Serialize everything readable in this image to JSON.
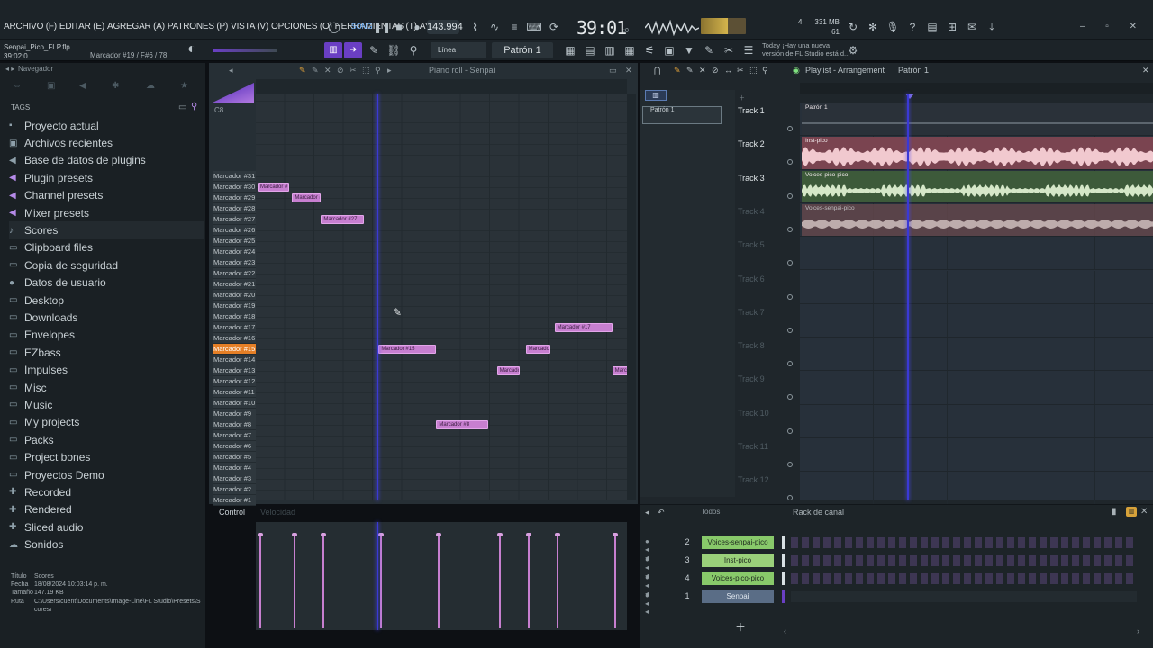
{
  "menu": [
    "ARCHIVO (F)",
    "EDITAR (E)",
    "AGREGAR (A)",
    "PATRONES (P)",
    "VISTA (V)",
    "OPCIONES (O)",
    "HERRAMIENTAS (T)",
    "AYUDA"
  ],
  "transport": {
    "tempo": "143.994",
    "clock": "39:01",
    "clock_sub": ":0",
    "memory": "331 MB",
    "memory_sub": "61",
    "cpu_value": "4"
  },
  "project": {
    "file": "Senpai_Pico_FLP.flp",
    "time": "39:02:0",
    "hint": "Marcador #19 / F#6 / 78"
  },
  "toolbar2": {
    "snap": "Línea",
    "pattern": "Patrón 1",
    "news": [
      "Today  ¡Hay una nueva",
      "versión de FL Studio está d..."
    ]
  },
  "browser": {
    "title": "Navegador",
    "tags": "TAGS",
    "items": [
      {
        "label": "Proyecto actual",
        "icon": "folder-icon",
        "glyph": "▪"
      },
      {
        "label": "Archivos recientes",
        "icon": "recent-icon",
        "glyph": "▣"
      },
      {
        "label": "Base de datos de plugins",
        "icon": "plugin-db-icon",
        "glyph": "◀"
      },
      {
        "label": "Plugin presets",
        "icon": "plugin-presets-icon",
        "glyph": "◀"
      },
      {
        "label": "Channel presets",
        "icon": "channel-presets-icon",
        "glyph": "◀"
      },
      {
        "label": "Mixer presets",
        "icon": "mixer-presets-icon",
        "glyph": "◀"
      },
      {
        "label": "Scores",
        "icon": "note-icon",
        "glyph": "♪"
      },
      {
        "label": "Clipboard files",
        "icon": "folder-icon",
        "glyph": "▭"
      },
      {
        "label": "Copia de seguridad",
        "icon": "backup-icon",
        "glyph": "▭"
      },
      {
        "label": "Datos de usuario",
        "icon": "user-icon",
        "glyph": "●"
      },
      {
        "label": "Desktop",
        "icon": "folder-icon",
        "glyph": "▭"
      },
      {
        "label": "Downloads",
        "icon": "folder-icon",
        "glyph": "▭"
      },
      {
        "label": "Envelopes",
        "icon": "folder-icon",
        "glyph": "▭"
      },
      {
        "label": "EZbass",
        "icon": "folder-icon",
        "glyph": "▭"
      },
      {
        "label": "Impulses",
        "icon": "folder-icon",
        "glyph": "▭"
      },
      {
        "label": "Misc",
        "icon": "folder-icon",
        "glyph": "▭"
      },
      {
        "label": "Music",
        "icon": "folder-icon",
        "glyph": "▭"
      },
      {
        "label": "My projects",
        "icon": "folder-icon",
        "glyph": "▭"
      },
      {
        "label": "Packs",
        "icon": "folder-icon",
        "glyph": "▭"
      },
      {
        "label": "Project bones",
        "icon": "folder-icon",
        "glyph": "▭"
      },
      {
        "label": "Proyectos Demo",
        "icon": "folder-icon",
        "glyph": "▭"
      },
      {
        "label": "Recorded",
        "icon": "recorded-icon",
        "glyph": "✚"
      },
      {
        "label": "Rendered",
        "icon": "rendered-icon",
        "glyph": "✚"
      },
      {
        "label": "Sliced audio",
        "icon": "sliced-icon",
        "glyph": "✚"
      },
      {
        "label": "Sonidos",
        "icon": "cloud-icon",
        "glyph": "☁"
      }
    ],
    "file_info": [
      {
        "k": "Título",
        "v": "Scores"
      },
      {
        "k": "Fecha",
        "v": "18/08/2024 10:03:14 p. m."
      },
      {
        "k": "Tamaño",
        "v": "147.19 KB"
      },
      {
        "k": "Ruta",
        "v": "C:\\Users\\cuent\\Documents\\Image-Line\\FL Studio\\Presets\\Scores\\"
      }
    ]
  },
  "piano_roll": {
    "title": "Piano roll - Senpai",
    "top_key": "C8",
    "control": "Control",
    "control_sub": "Velocidad",
    "keys": [
      "Marcador #31",
      "Marcador #30",
      "Marcador #29",
      "Marcador #28",
      "Marcador #27",
      "Marcador #26",
      "Marcador #25",
      "Marcador #24",
      "Marcador #23",
      "Marcador #22",
      "Marcador #21",
      "Marcador #20",
      "Marcador #19",
      "Marcador #18",
      "Marcador #17",
      "Marcador #16",
      "Marcador #15",
      "Marcador #14",
      "Marcador #13",
      "Marcador #12",
      "Marcador #11",
      "Marcador #10",
      "Marcador #9",
      "Marcador #8",
      "Marcador #7",
      "Marcador #6",
      "Marcador #5",
      "Marcador #4",
      "Marcador #3",
      "Marcador #2",
      "Marcador #1"
    ],
    "active_key": "Marcador #15",
    "notes": [
      {
        "label": "Marcador #",
        "row": 1,
        "start": 0,
        "len": 1.1
      },
      {
        "label": "Marcador #",
        "row": 2,
        "start": 1.2,
        "len": 1.0
      },
      {
        "label": "Marcador #27",
        "row": 4,
        "start": 2.2,
        "len": 1.5
      },
      {
        "label": "Marcador #17",
        "row": 14,
        "start": 10.3,
        "len": 2.0
      },
      {
        "label": "Marcador #15",
        "row": 16,
        "start": 4.2,
        "len": 2.0
      },
      {
        "label": "Marcador",
        "row": 16,
        "start": 9.3,
        "len": 0.85
      },
      {
        "label": "Marcador",
        "row": 18,
        "start": 8.3,
        "len": 0.8
      },
      {
        "label": "Marc",
        "row": 18,
        "start": 12.3,
        "len": 0.55
      },
      {
        "label": "Marcador #8",
        "row": 23,
        "start": 6.2,
        "len": 1.8
      }
    ],
    "velocities": [
      0,
      1.2,
      2.2,
      4.2,
      6.2,
      8.3,
      9.3,
      10.3,
      12.3
    ]
  },
  "playlist": {
    "title": "Playlist - Arrangement",
    "pattern": "Patrón 1",
    "picker": "Patrón 1",
    "tracks": [
      {
        "label": "Track 1",
        "clip": "Patrón 1",
        "type": "pattern",
        "active": true
      },
      {
        "label": "Track 2",
        "clip": "Inst-pico",
        "type": "audio",
        "active": true
      },
      {
        "label": "Track 3",
        "clip": "Voices-pico-pico",
        "type": "audio",
        "active": true
      },
      {
        "label": "Track 4",
        "clip": "Voices-senpai-pico",
        "type": "audio",
        "active": false
      },
      {
        "label": "Track 5",
        "clip": "",
        "active": false
      },
      {
        "label": "Track 6",
        "clip": "",
        "active": false
      },
      {
        "label": "Track 7",
        "clip": "",
        "active": false
      },
      {
        "label": "Track 8",
        "clip": "",
        "active": false
      },
      {
        "label": "Track 9",
        "clip": "",
        "active": false
      },
      {
        "label": "Track 10",
        "clip": "",
        "active": false
      },
      {
        "label": "Track 11",
        "clip": "",
        "active": false
      },
      {
        "label": "Track 12",
        "clip": "",
        "active": false
      }
    ],
    "clip_colors": {
      "audio1": "#7a4450",
      "audio2": "#3d5a3a",
      "audio3": "#6a4a4e"
    }
  },
  "channel_rack": {
    "title": "Rack de canal",
    "filter": "Todos",
    "channels": [
      {
        "num": "2",
        "name": "Voices-senpai-pico",
        "color": "#88c96a"
      },
      {
        "num": "3",
        "name": "Inst-pico",
        "color": "#9ad07a"
      },
      {
        "num": "4",
        "name": "Voices-pico-pico",
        "color": "#88c96a"
      },
      {
        "num": "1",
        "name": "Senpai",
        "color": "#5a6d86"
      }
    ]
  },
  "colors": {
    "accent": "#6a3fc4",
    "note": "#c77fd0",
    "active_key": "#e57f26",
    "playhead": "#3a39d6"
  }
}
